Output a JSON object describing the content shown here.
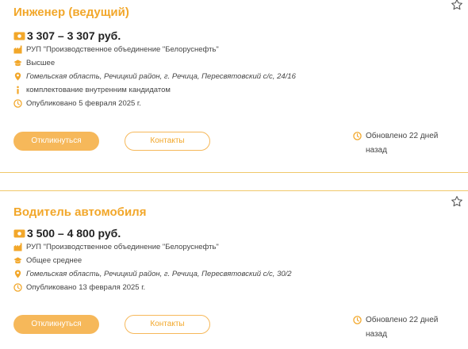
{
  "colors": {
    "accent": "#f2a72a",
    "button_fill": "#f6b85a",
    "divider": "#f0c86a"
  },
  "vacancies": [
    {
      "title": "Инженер (ведущий)",
      "salary": "3 307 – 3 307 руб.",
      "company": "РУП \"Производственное объединение \"Белоруснефть\"",
      "education": "Высшее",
      "location": "Гомельская область, Речицкий район, г. Речица, Пересвятовский с/с, 24/16",
      "note": "комплектование внутренним кандидатом",
      "published": "Опубликовано 5 февраля 2025 г.",
      "apply_label": "Откликнуться",
      "contacts_label": "Контакты",
      "updated": "Обновлено 22 дней назад"
    },
    {
      "title": "Водитель автомобиля",
      "salary": "3 500 – 4 800 руб.",
      "company": "РУП \"Производственное объединение \"Белоруснефть\"",
      "education": "Общее среднее",
      "location": "Гомельская область, Речицкий район, г. Речица, Пересвятовский с/с, 30/2",
      "published": "Опубликовано 13 февраля 2025 г.",
      "apply_label": "Откликнуться",
      "contacts_label": "Контакты",
      "updated": "Обновлено 22 дней назад"
    }
  ],
  "icons": {
    "favorite": "star-outline-icon",
    "salary": "money-icon",
    "company": "factory-icon",
    "education": "graduation-cap-icon",
    "location": "map-pin-icon",
    "note": "info-icon",
    "published": "clock-icon"
  }
}
